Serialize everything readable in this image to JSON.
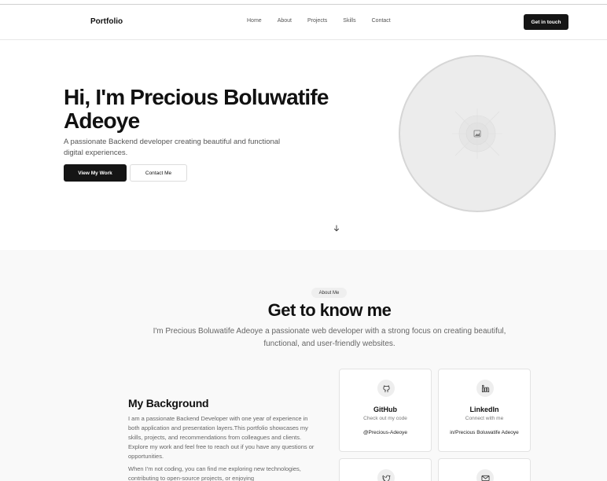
{
  "nav": {
    "brand": "Portfolio",
    "links": [
      "Home",
      "About",
      "Projects",
      "Skills",
      "Contact"
    ],
    "cta": "Get in touch"
  },
  "hero": {
    "title": "Hi, I'm Precious Boluwatife Adeoye",
    "subtitle": "A passionate Backend developer creating beautiful and functional digital experiences.",
    "primary_button": "View My Work",
    "secondary_button": "Contact Me",
    "scroll_icon": "arrow-down-icon"
  },
  "about": {
    "pill": "About Me",
    "title": "Get to know me",
    "subtitle": "I'm Precious Boluwatife Adeoye a passionate web developer with a strong focus on creating beautiful, functional, and user-friendly websites.",
    "background_title": "My Background",
    "background_p1": "I am a passionate Backend Developer with one year of experience in both application and presentation layers.This portfolio showcases my skills, projects, and recommendations from colleagues and clients. Explore my work and feel free to reach out if you have any questions or opportunities.",
    "background_p2": "When I'm not coding, you can find me exploring new technologies, contributing to open-source projects, or enjoying",
    "cards": [
      {
        "icon": "github-icon",
        "title": "GitHub",
        "sub": "Check out my code",
        "handle": "@Precious-Adeoye"
      },
      {
        "icon": "linkedin-icon",
        "title": "LinkedIn",
        "sub": "Connect with me",
        "handle": "in/Precious Boluwatife Adeoye"
      },
      {
        "icon": "twitter-icon"
      },
      {
        "icon": "mail-icon"
      }
    ]
  }
}
